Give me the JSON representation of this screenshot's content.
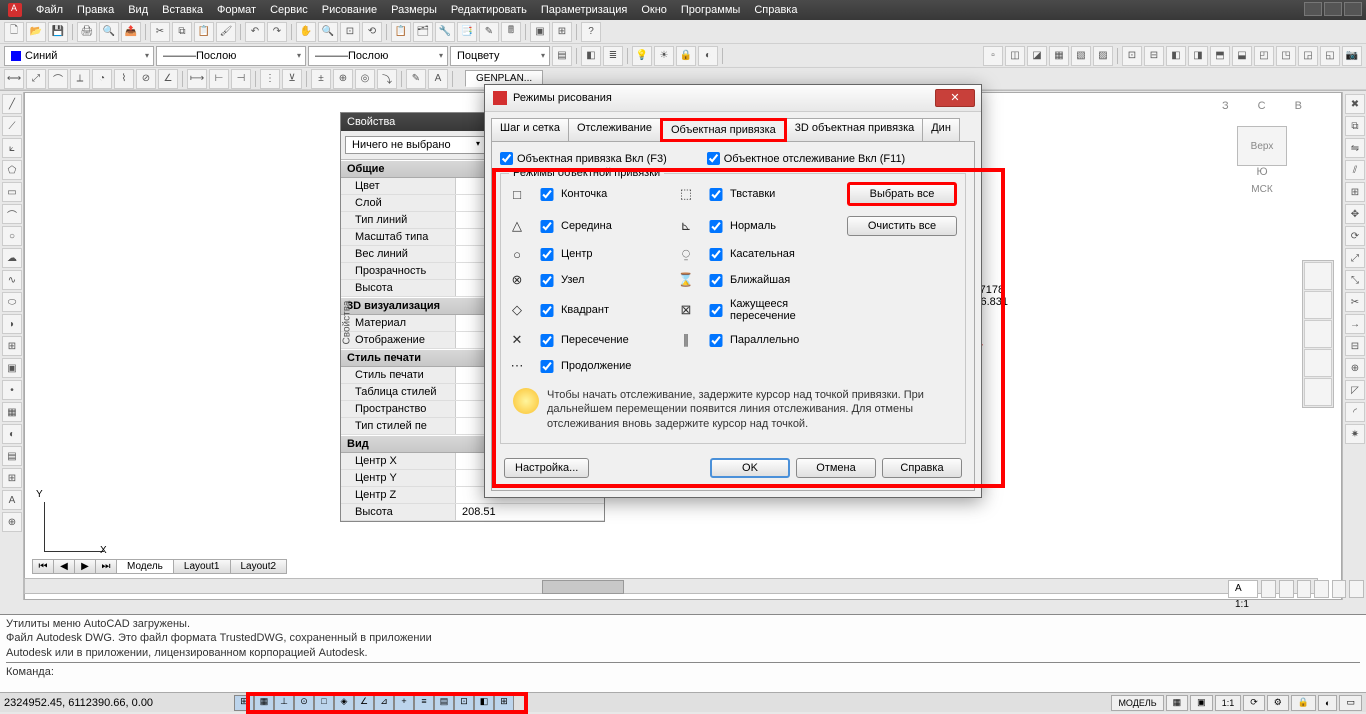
{
  "menu": [
    "Файл",
    "Правка",
    "Вид",
    "Вставка",
    "Формат",
    "Сервис",
    "Рисование",
    "Размеры",
    "Редактировать",
    "Параметризация",
    "Окно",
    "Программы",
    "Справка"
  ],
  "layer_color": "Синий",
  "linetype": "Послою",
  "linetype2": "Послою",
  "lineweight": "Поцвету",
  "doc_tab": "GENPLAN...",
  "props": {
    "title": "Свойства",
    "sel": "Ничего не выбрано",
    "groups": {
      "g1": "Общие",
      "g2": "3D визуализация",
      "g3": "Стиль печати",
      "g4": "Вид"
    },
    "rows": {
      "color": "Цвет",
      "layer": "Слой",
      "ltype": "Тип линий",
      "lscale": "Масштаб типа",
      "lweight": "Вес линий",
      "transp": "Прозрачность",
      "height1": "Высота",
      "material": "Материал",
      "display": "Отображение",
      "pstyle": "Стиль печати",
      "ptable": "Таблица стилей",
      "pspace": "Пространство",
      "pstylet": "Тип стилей пе",
      "cx": "Центр X",
      "cy": "Центр Y",
      "cz": "Центр Z",
      "height2": "Высота"
    },
    "val_height": "208.51"
  },
  "dialog": {
    "title": "Режимы рисования",
    "tabs": [
      "Шаг и сетка",
      "Отслеживание",
      "Объектная привязка",
      "3D объектная привязка",
      "Дин"
    ],
    "osnap_on": "Объектная привязка Вкл (F3)",
    "otrack_on": "Объектное отслеживание Вкл (F11)",
    "legend": "Режимы объектной привязки",
    "snaps": {
      "endpoint": "Конточка",
      "midpoint": "Середина",
      "center": "Центр",
      "node": "Узел",
      "quadrant": "Квадрант",
      "intersection": "Пересечение",
      "extension": "Продолжение",
      "insertion": "Твставки",
      "perpendicular": "Нормаль",
      "tangent": "Касательная",
      "nearest": "Ближайшая",
      "apparent": "Кажущееся пересечение",
      "parallel": "Параллельно"
    },
    "select_all": "Выбрать все",
    "clear_all": "Очистить все",
    "hint": "Чтобы начать отслеживание, задержите курсор над точкой привязки. При дальнейшем перемещении появится линия отслеживания. Для отмены отслеживания вновь задержите курсор над точкой.",
    "settings": "Настройка...",
    "ok": "OK",
    "cancel": "Отмена",
    "help": "Справка"
  },
  "viewcube": {
    "top": "Верх",
    "n": "С",
    "s": "Ю",
    "e": "В",
    "w": "З",
    "wcs": "МСК"
  },
  "tabs_bottom": [
    "Модель",
    "Layout1",
    "Layout2"
  ],
  "cmd": {
    "l1": "Утилиты меню AutoCAD загружены.",
    "l2": "Файл Autodesk DWG. Это файл формата TrustedDWG, сохраненный в приложении",
    "l3": "Autodesk или в приложении, лицензированном корпорацией Autodesk.",
    "prompt": "Команда:"
  },
  "status": {
    "coords": "2324952.45, 6112390.66, 0.00",
    "model": "МОДЕЛЬ",
    "scale": "1:1"
  },
  "ucs": {
    "x": "X",
    "y": "Y"
  },
  "scale_right": "А 1:1"
}
